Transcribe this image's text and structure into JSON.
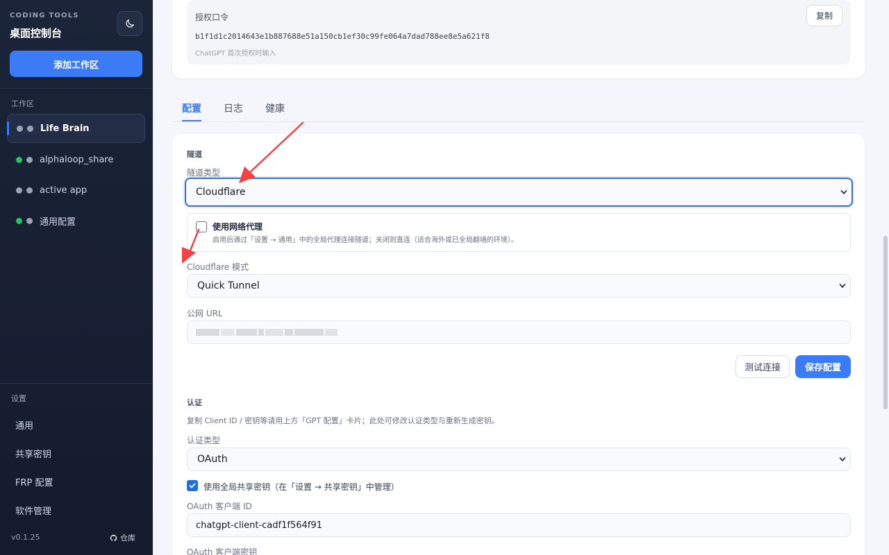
{
  "sidebar": {
    "brand_sub": "CODING TOOLS",
    "brand_title": "桌面控制台",
    "add_workspace": "添加工作区",
    "workspace_section": "工作区",
    "workspaces": [
      {
        "label": "Life Brain",
        "dot1": "#9aa3b5",
        "dot2": "#9aa3b5",
        "active": true
      },
      {
        "label": "alphaloop_share",
        "dot1": "#22c55e",
        "dot2": "#9aa3b5"
      },
      {
        "label": "active app",
        "dot1": "#9aa3b5",
        "dot2": "#9aa3b5"
      },
      {
        "label": "通用配置",
        "dot1": "#22c55e",
        "dot2": "#9aa3b5"
      }
    ],
    "settings_section": "设置",
    "settings": [
      "通用",
      "共享密钥",
      "FRP 配置",
      "软件管理"
    ],
    "version": "v0.1.25",
    "repo": "仓库"
  },
  "token": {
    "label": "授权口令",
    "value": "b1f1d1c2014643e1b887688e51a150cb1ef30c99fe064a7dad788ee8e5a621f8",
    "hint": "ChatGPT 首次授权时输入",
    "copy": "复制"
  },
  "tabs": [
    "配置",
    "日志",
    "健康"
  ],
  "tunnel": {
    "section": "隧道",
    "type_label": "隧道类型",
    "type_value": "Cloudflare",
    "proxy_title": "使用网络代理",
    "proxy_desc": "启用后通过「设置 → 通用」中的全局代理连接隧道；关闭则直连（适合海外或已全局翻墙的环境）。",
    "mode_label": "Cloudflare 模式",
    "mode_value": "Quick Tunnel",
    "url_label": "公网 URL",
    "test_btn": "测试连接",
    "save_btn": "保存配置"
  },
  "auth": {
    "section": "认证",
    "desc": "复制 Client ID / 密钥等请用上方「GPT 配置」卡片；此处可修改认证类型与重新生成密钥。",
    "type_label": "认证类型",
    "type_value": "OAuth",
    "shared_key_label": "使用全局共享密钥（在「设置 → 共享密钥」中管理）",
    "client_id_label": "OAuth 客户端 ID",
    "client_id_value": "chatgpt-client-cadf1f564f91",
    "client_secret_label": "OAuth 客户端密钥"
  },
  "colors": {
    "accent": "#3b7bf6",
    "annotation": "#ef4444"
  }
}
